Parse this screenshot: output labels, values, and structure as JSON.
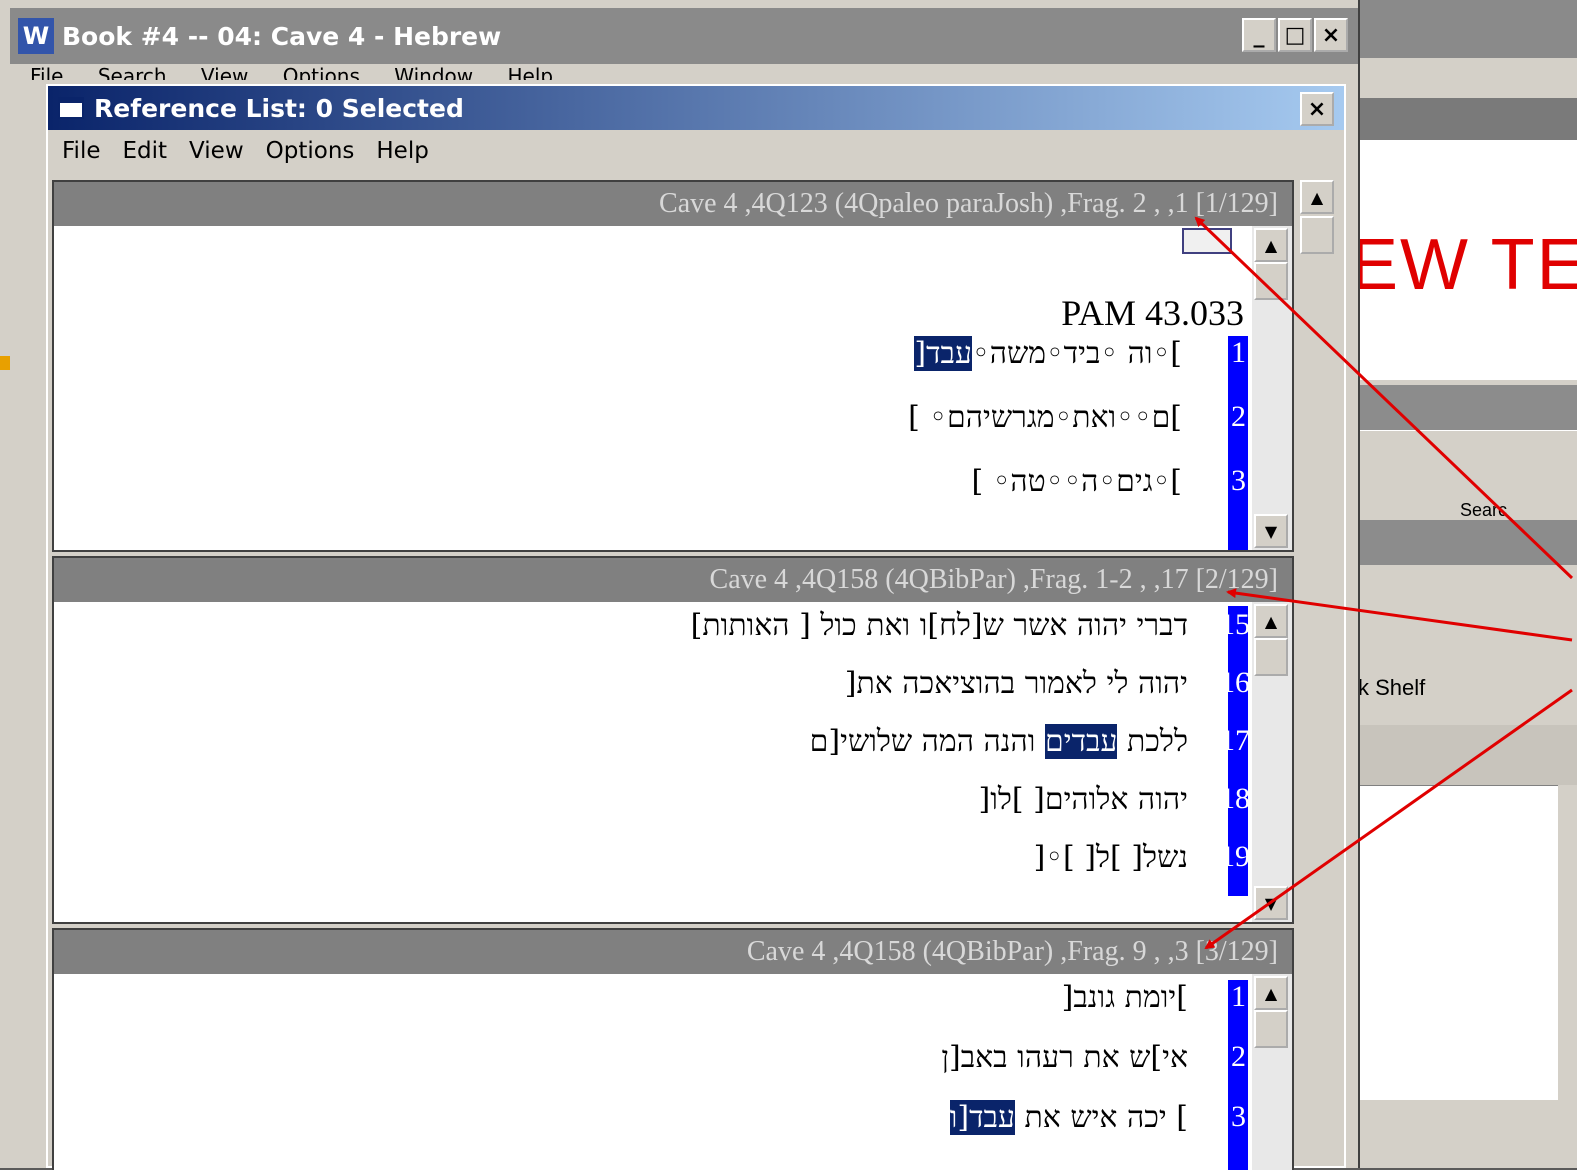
{
  "background_window": {
    "slide_title_fragment": "EW TE",
    "search_label": "Searc",
    "shelf_label": "k Shelf"
  },
  "book_window": {
    "icon_letter": "W",
    "title": "Book #4 -- 04: Cave 4 - Hebrew",
    "menu": [
      "File",
      "Search",
      "View",
      "Options",
      "Window",
      "Help"
    ],
    "buttons": [
      "_",
      "□",
      "×"
    ]
  },
  "ref_window": {
    "title": "Reference List:  0 Selected",
    "close": "×",
    "menu": [
      "File",
      "Edit",
      "View",
      "Options",
      "Help"
    ]
  },
  "panes": [
    {
      "header": "Cave 4 ,4Q123 (4Qpaleo paraJosh) ,Frag. 2 , ,1  [1/129]",
      "pam": "PAM 43.033",
      "lines": [
        {
          "num": "1",
          "pre": "]◦וה ◦ביד◦משה◦",
          "hl": "עבד[",
          "post": ""
        },
        {
          "num": "2",
          "pre": "]ם◦◦ואת◦מגרשיהם◦ ]",
          "hl": "",
          "post": ""
        },
        {
          "num": "3",
          "pre": "]◦גים◦ה◦◦טה◦       ]",
          "hl": "",
          "post": ""
        }
      ]
    },
    {
      "header": "Cave 4 ,4Q158 (4QBibPar) ,Frag. 1-2 , ,17  [2/129]",
      "lines": [
        {
          "num": "15",
          "pre": "דברי יהוה אשר ש[לח]ו ואת כול [ האותות]",
          "hl": "",
          "post": ""
        },
        {
          "num": "16",
          "pre": "יהוה לי לאמור בהוציאכה את[",
          "hl": "",
          "post": ""
        },
        {
          "num": "17",
          "pre": "ללכת ",
          "hl": "עבדים",
          "post": " והנה המה שלושי[ם"
        },
        {
          "num": "18",
          "pre": "יהוה אלוהים[             ]לו[",
          "hl": "",
          "post": ""
        },
        {
          "num": "19",
          "pre": "נשל[ ]ל[ ]◦[",
          "hl": "",
          "post": ""
        }
      ]
    },
    {
      "header": "Cave 4 ,4Q158 (4QBibPar) ,Frag. 9 , ,3  [3/129]",
      "lines": [
        {
          "num": "1",
          "pre": "]יומת   גונב[",
          "hl": "",
          "post": ""
        },
        {
          "num": "2",
          "pre": "אי]ש את רעהו באב[ן",
          "hl": "",
          "post": ""
        },
        {
          "num": "3",
          "pre": "] יכה איש את ",
          "hl": "עבד[ו",
          "post": ""
        }
      ]
    }
  ],
  "colors": {
    "arrow": "#e00000",
    "highlight": "#0a246a",
    "line_number_bar": "#0000ff",
    "pane_header": "#808080"
  }
}
